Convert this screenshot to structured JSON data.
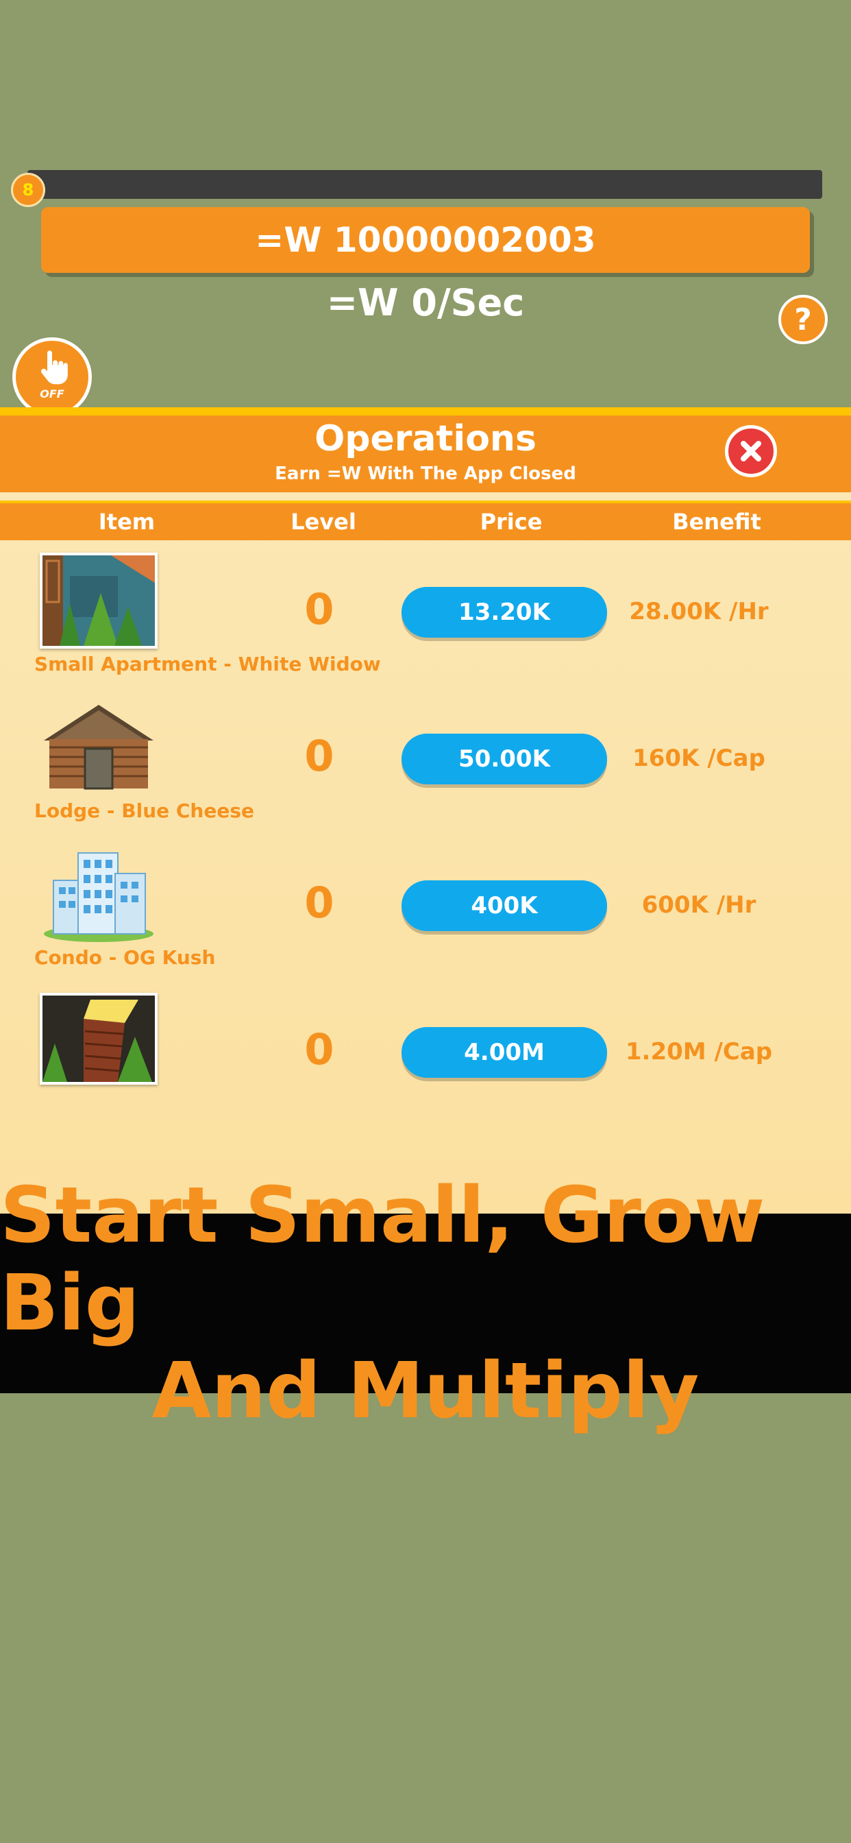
{
  "hud": {
    "level": "8",
    "money": "=W 10000002003",
    "rate": "=W 0/Sec",
    "help_label": "?",
    "auto_label": "OFF"
  },
  "panel": {
    "title": "Operations",
    "subtitle": "Earn =W With The App Closed",
    "columns": [
      "Item",
      "Level",
      "Price",
      "Benefit"
    ],
    "rows": [
      {
        "name": "Small Apartment - White Widow",
        "level": "0",
        "price": "13.20K",
        "benefit": "28.00K /Hr"
      },
      {
        "name": "Lodge - Blue Cheese",
        "level": "0",
        "price": "50.00K",
        "benefit": "160K /Cap"
      },
      {
        "name": "Condo - OG Kush",
        "level": "0",
        "price": "400K",
        "benefit": "600K /Hr"
      },
      {
        "name": "",
        "level": "0",
        "price": "4.00M",
        "benefit": "1.20M /Cap"
      }
    ]
  },
  "caption": {
    "line1": "Start Small, Grow Big",
    "line2": "And Multiply"
  },
  "colors": {
    "background": "#8e9b6a",
    "orange": "#f5921f",
    "blue_button": "#10a9ec",
    "panel_bg": "#fbe8b6",
    "close_red": "#e83a3a"
  }
}
